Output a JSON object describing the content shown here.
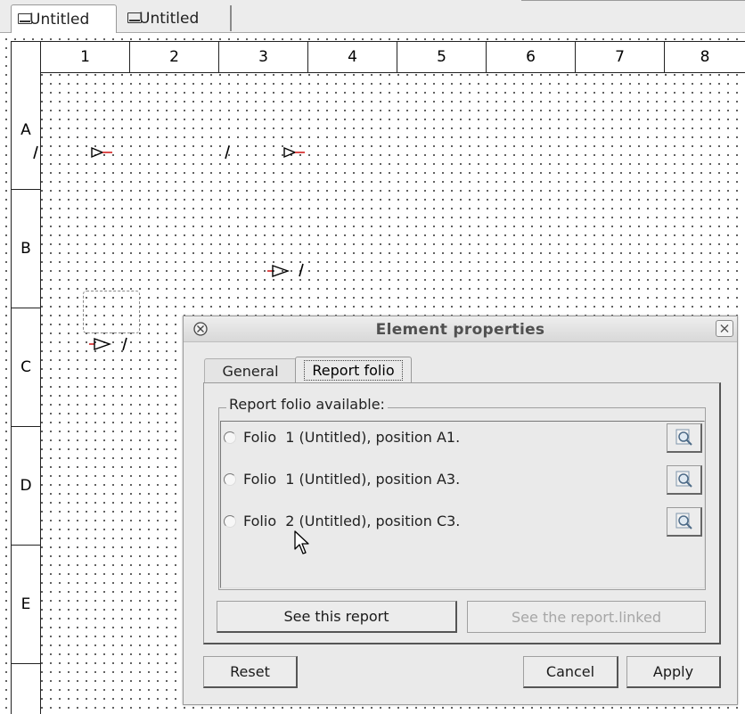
{
  "tabs": [
    {
      "label": "Untitled",
      "active": true
    },
    {
      "label": "Untitled",
      "active": false
    }
  ],
  "grid": {
    "columns": [
      "1",
      "2",
      "3",
      "4",
      "5",
      "6",
      "7",
      "8"
    ],
    "rows": [
      "A",
      "B",
      "C",
      "D",
      "E"
    ]
  },
  "dialog": {
    "title": "Element properties",
    "tabs": {
      "general": "General",
      "report_folio": "Report folio"
    },
    "group_title": "Report folio available:",
    "folios": [
      {
        "label": "Folio  1 (Untitled), position A1."
      },
      {
        "label": "Folio  1 (Untitled), position A3."
      },
      {
        "label": "Folio  2 (Untitled), position C3."
      }
    ],
    "see_report_label": "See this report",
    "see_linked_label": "See the report.linked",
    "reset_label": "Reset",
    "cancel_label": "Cancel",
    "apply_label": "Apply"
  },
  "icons": {
    "tab": "folio-icon",
    "find": "magnifier-icon",
    "close": "close-icon",
    "menu": "circle-x-icon"
  },
  "colors": {
    "dialog_bg": "#eaeaea",
    "grid_line": "#222222",
    "disabled_text": "#a6a6a6",
    "wire_red": "#cc0000"
  }
}
